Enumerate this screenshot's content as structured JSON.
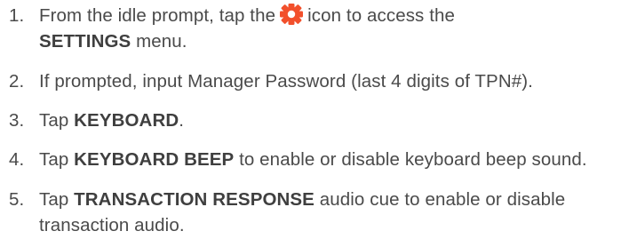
{
  "steps": [
    {
      "number": "1.",
      "before_icon": "From the idle prompt, tap the",
      "icon": "settings-gear-icon",
      "after_icon": "icon to access the",
      "bold": "SETTINGS",
      "after_bold": "menu."
    },
    {
      "number": "2.",
      "text": "If prompted, input Manager Password (last 4 digits of TPN#)."
    },
    {
      "number": "3.",
      "before_bold": "Tap",
      "bold": "KEYBOARD",
      "after_bold": "."
    },
    {
      "number": "4.",
      "before_bold": "Tap",
      "bold": "KEYBOARD BEEP",
      "after_bold": "to enable or disable keyboard beep sound."
    },
    {
      "number": "5.",
      "before_bold": "Tap",
      "bold": "TRANSACTION RESPONSE",
      "after_bold": "audio cue to enable or disable transaction audio."
    }
  ],
  "colors": {
    "text": "#4a4a4a",
    "icon": "#f2502c"
  }
}
